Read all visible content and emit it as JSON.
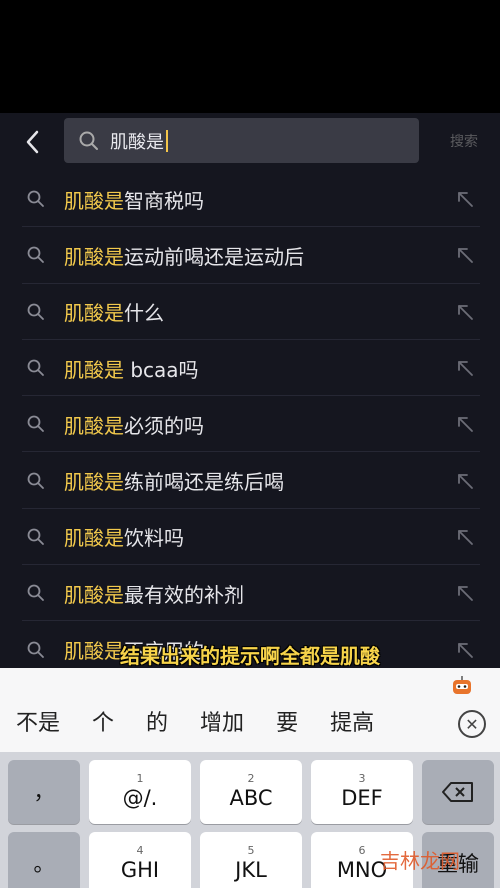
{
  "search": {
    "value": "肌酸是",
    "button_label": "搜索"
  },
  "suggestions": [
    {
      "highlight": "肌酸是",
      "rest": "智商税吗"
    },
    {
      "highlight": "肌酸是",
      "rest": "运动前喝还是运动后"
    },
    {
      "highlight": "肌酸是",
      "rest": "什么"
    },
    {
      "highlight": "肌酸是",
      "rest": " bcaa吗"
    },
    {
      "highlight": "肌酸是",
      "rest": "必须的吗"
    },
    {
      "highlight": "肌酸是",
      "rest": "练前喝还是练后喝"
    },
    {
      "highlight": "肌酸是",
      "rest": "饮料吗"
    },
    {
      "highlight": "肌酸是",
      "rest": "最有效的补剂"
    },
    {
      "highlight": "肌酸是",
      "rest": "不应用的"
    }
  ],
  "caption": "结果出来的提示啊全都是肌酸",
  "candidates": [
    "不是",
    "个",
    "的",
    "增加",
    "要",
    "提高"
  ],
  "keyboard": {
    "row1": [
      {
        "num": "",
        "label": "，"
      },
      {
        "num": "1",
        "label": "@/."
      },
      {
        "num": "2",
        "label": "ABC"
      },
      {
        "num": "3",
        "label": "DEF"
      }
    ],
    "row2": [
      {
        "num": "",
        "label": "。"
      },
      {
        "num": "4",
        "label": "GHI"
      },
      {
        "num": "5",
        "label": "JKL"
      },
      {
        "num": "6",
        "label": "MNO"
      },
      {
        "num": "",
        "label": "重输"
      }
    ]
  },
  "watermark": "吉林龙网",
  "colors": {
    "highlight": "#f2c94c",
    "background": "#15161f",
    "caption": "#f7d44a"
  }
}
